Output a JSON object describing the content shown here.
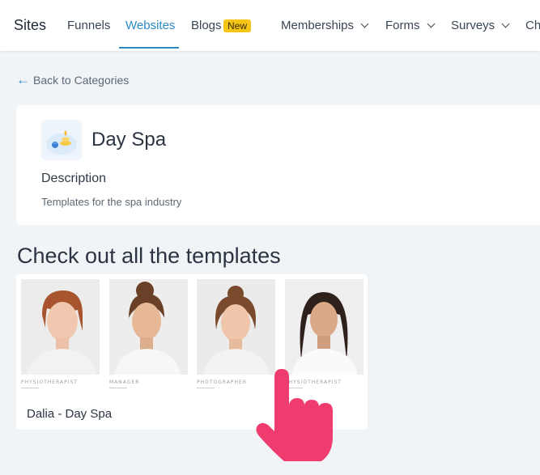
{
  "nav": {
    "brand": "Sites",
    "items": [
      {
        "label": "Funnels"
      },
      {
        "label": "Websites"
      },
      {
        "label": "Blogs"
      },
      {
        "label": "Memberships"
      },
      {
        "label": "Forms"
      },
      {
        "label": "Surveys"
      },
      {
        "label": "Cha"
      }
    ],
    "blogs_badge": "New"
  },
  "back_link": "Back to Categories",
  "category": {
    "title": "Day Spa",
    "description_label": "Description",
    "description": "Templates for the spa industry",
    "icon": "spa-stones-icon"
  },
  "section_title": "Check out all the templates",
  "template": {
    "name": "Dalia - Day Spa",
    "thumbnails": [
      {
        "role": "PHYSIOTHERAPIST"
      },
      {
        "role": "MANAGER"
      },
      {
        "role": "PHOTOGRAPHER"
      },
      {
        "role": "PHYSIOTHERAPIST"
      }
    ]
  },
  "colors": {
    "accent": "#2b8ac8",
    "badge": "#f5c518",
    "pointer": "#ef3c6e"
  }
}
